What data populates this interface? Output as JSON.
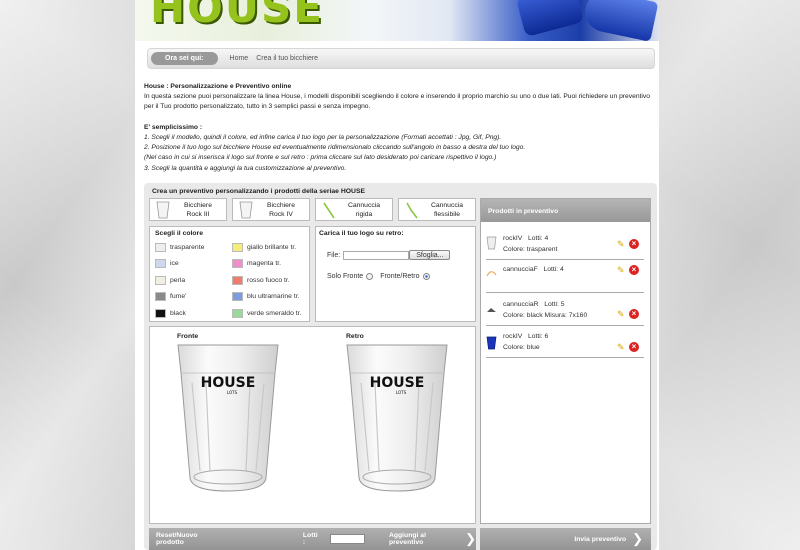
{
  "banner": {
    "logo": "HOUSE"
  },
  "breadcrumb": {
    "label": "Ora sei qui:",
    "home": "Home",
    "current": "Crea il tuo bicchiere"
  },
  "intro": {
    "title": "House : Personalizzazione e Preventivo online",
    "p1": "In questa sezione puoi personalizzare la linea House, i modelli disponibili scegliendo il colore e inserendo il proprio marchio su uno o due lati. Puoi richiedere un preventivo per il Tuo prodotto personalizzato, tutto in 3 semplici passi e senza impegno.",
    "easy": "E' semplicissimo :",
    "step1": "1. Scegli il modello, quindi il colore, ed infine carica il tuo logo per la personalizzazione (Formati accettati : Jpg, Gif, Png).",
    "step2": "2. Posizione il tuo logo sul bicchiere House ed eventualmente ridimensionalo cliccando sull'angolo in basso a destra del tuo logo.",
    "step2b": "(Nel caso in cui si inserisca il logo sul fronte e sul retro : prima cliccare sul lato desiderato poi caricare rispettivo il logo.)",
    "step3": "3. Scegli la quantità e aggiungi la tua customizzazione al preventivo."
  },
  "configurator": {
    "title": "Crea un preventivo personalizzando i prodotti della seriae HOUSE"
  },
  "products": [
    {
      "line1": "Bicchiere",
      "line2": "Rock III"
    },
    {
      "line1": "Bicchiere",
      "line2": "Rock IV"
    },
    {
      "line1": "Cannuccia",
      "line2": "rigida"
    },
    {
      "line1": "Cannuccia",
      "line2": "flessibile"
    }
  ],
  "colors": {
    "title": "Scegli il colore",
    "items": [
      {
        "label": "trasparente",
        "color": "#eeeeee"
      },
      {
        "label": "giallo brillante tr.",
        "color": "#f2ee7a"
      },
      {
        "label": "ice",
        "color": "#cfd8ea"
      },
      {
        "label": "magenta tr.",
        "color": "#f08fc6"
      },
      {
        "label": "perla",
        "color": "#f3eee2"
      },
      {
        "label": "rosso fuoco tr.",
        "color": "#f07b6e"
      },
      {
        "label": "fume'",
        "color": "#8a8a8a"
      },
      {
        "label": "blu ultramarine tr.",
        "color": "#7f9be0"
      },
      {
        "label": "black",
        "color": "#111111"
      },
      {
        "label": "verde smeraldo tr.",
        "color": "#9ad89b"
      }
    ]
  },
  "upload": {
    "title": "Carica il tuo logo su retro:",
    "file_label": "File:",
    "browse": "Sfoglia...",
    "front_only": "Solo Fronte",
    "front_back": "Fronte/Retro"
  },
  "preview": {
    "front": "Fronte",
    "back": "Retro",
    "logo": "HOUSE",
    "logo_sub": "LOTS"
  },
  "cart": {
    "title": "Prodotti in preventivo",
    "items": [
      {
        "name": "rockIV",
        "lots_label": "Lotti: 4",
        "color_label": "Colore: trasparent",
        "icon": "glass-clear"
      },
      {
        "name": "cannucciaF",
        "lots_label": "Lotti: 4",
        "color_label": "",
        "icon": "straw-orange"
      },
      {
        "name": "cannucciaR",
        "lots_label": "Lotti: 5",
        "color_label": "Colore: black Misura: 7x160",
        "icon": "straw-black"
      },
      {
        "name": "rockIV",
        "lots_label": "Lotti: 6",
        "color_label": "Colore: blue",
        "icon": "glass-blue"
      }
    ]
  },
  "actions": {
    "reset": "Reset/Nuovo prodotto",
    "lots_label": "Lotti :",
    "lots_value": "",
    "add": "Aggiungi al preventivo",
    "send": "Invia preventivo"
  }
}
